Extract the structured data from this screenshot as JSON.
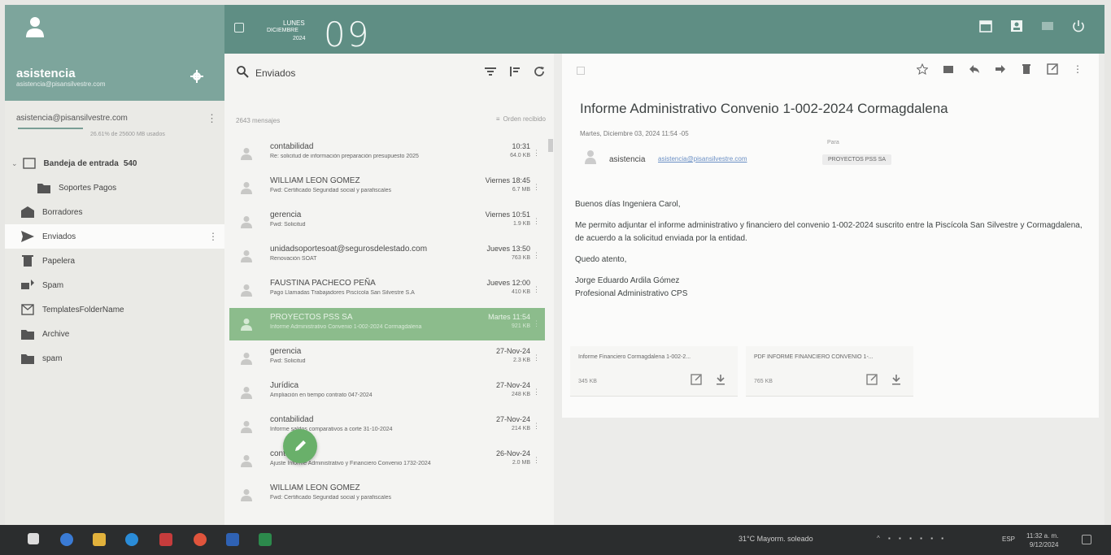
{
  "profile": {
    "name": "asistencia",
    "email": "asistencia@pisansilvestre.com"
  },
  "account": {
    "email": "asistencia@pisansilvestre.com",
    "quota": "26.61% de 25600 MB usados"
  },
  "folders": [
    {
      "label": "Bandeja de entrada",
      "count": "540",
      "icon": "inbox-icon"
    },
    {
      "label": "Soportes Pagos",
      "count": "",
      "icon": "folder-icon"
    },
    {
      "label": "Borradores",
      "count": "",
      "icon": "drafts-icon"
    },
    {
      "label": "Enviados",
      "count": "",
      "icon": "send-icon"
    },
    {
      "label": "Papelera",
      "count": "",
      "icon": "trash-icon"
    },
    {
      "label": "Spam",
      "count": "",
      "icon": "spam-icon"
    },
    {
      "label": "TemplatesFolderName",
      "count": "",
      "icon": "template-icon"
    },
    {
      "label": "Archive",
      "count": "",
      "icon": "folder-icon"
    },
    {
      "label": "spam",
      "count": "",
      "icon": "folder-icon"
    }
  ],
  "topbar": {
    "day_name": "LUNES",
    "month": "DICIEMBRE",
    "year": "2024",
    "day_number": "09"
  },
  "list": {
    "search_label": "Enviados",
    "count_label": "2643 mensajes",
    "sort_label": "Orden recibido",
    "messages": [
      {
        "sender": "contabilidad",
        "subject": "Re: solicitud de información preparación presupuesto 2025",
        "date": "10:31",
        "size": "64.0 KB"
      },
      {
        "sender": "WILLIAM LEON GOMEZ",
        "subject": "Fwd: Certificado Seguridad social y parafiscales",
        "date": "Viernes 18:45",
        "size": "6.7 MB"
      },
      {
        "sender": "gerencia",
        "subject": "Fwd: Solicitud",
        "date": "Viernes 10:51",
        "size": "1.9 KB"
      },
      {
        "sender": "unidadsoportesoat@segurosdelestado.com",
        "subject": "Renovación SOAT",
        "date": "Jueves 13:50",
        "size": "763 KB"
      },
      {
        "sender": "FAUSTINA PACHECO PEÑA",
        "subject": "Pago Llamadas Trabajadores Piscícola San Silvestre S.A",
        "date": "Jueves 12:00",
        "size": "410 KB"
      },
      {
        "sender": "PROYECTOS PSS SA",
        "subject": "Informe Administrativo Convenio 1-002-2024 Cormagdalena",
        "date": "Martes 11:54",
        "size": "921 KB"
      },
      {
        "sender": "gerencia",
        "subject": "Fwd: Solicitud",
        "date": "27-Nov-24",
        "size": "2.3 KB"
      },
      {
        "sender": "Jurídica",
        "subject": "Ampliación en tiempo contrato 047-2024",
        "date": "27-Nov-24",
        "size": "248 KB"
      },
      {
        "sender": "contabilidad",
        "subject": "Informe saldos comparativos a corte 31-10-2024",
        "date": "27-Nov-24",
        "size": "214 KB"
      },
      {
        "sender": "contabilidad",
        "subject": "Ajuste Informe Administrativo y Financiero Convenio 1732-2024",
        "date": "26-Nov-24",
        "size": "2.0 MB"
      },
      {
        "sender": "WILLIAM LEON GOMEZ",
        "subject": "Fwd: Certificado Seguridad social y parafiscales",
        "date": "",
        "size": ""
      }
    ]
  },
  "mail": {
    "title": "Informe Administrativo Convenio 1-002-2024 Cormagdalena",
    "date": "Martes, Diciembre 03, 2024 11:54 -05",
    "from_name": "asistencia",
    "from_email": "asistencia@pisansilvestre.com",
    "to_label": "Para",
    "to_chip": "PROYECTOS PSS SA",
    "body": [
      "Buenos días Ingeniera Carol,",
      "Me permito adjuntar el informe administrativo y financiero del convenio 1-002-2024 suscrito entre la Piscícola San Silvestre y Cormagdalena, de acuerdo a la solicitud enviada por la entidad.",
      "Quedo atento,"
    ],
    "signature_name": "Jorge Eduardo Ardila Gómez",
    "signature_title": "Profesional Administrativo CPS",
    "attachments": [
      {
        "name": "Informe Financiero Cormagdalena 1-002-2...",
        "size": "345 KB"
      },
      {
        "name": "PDF  INFORME FINANCIERO CONVENIO 1-...",
        "size": "765 KB"
      }
    ]
  },
  "taskbar": {
    "weather": "31°C  Mayorm. soleado",
    "lang": "ESP",
    "time": "11:32 a. m.",
    "date": "9/12/2024"
  },
  "colors": {
    "topbar": "#5f8e84",
    "profile": "#7da59c",
    "selected_row": "#8cbc8c",
    "fab": "#69b06a"
  }
}
